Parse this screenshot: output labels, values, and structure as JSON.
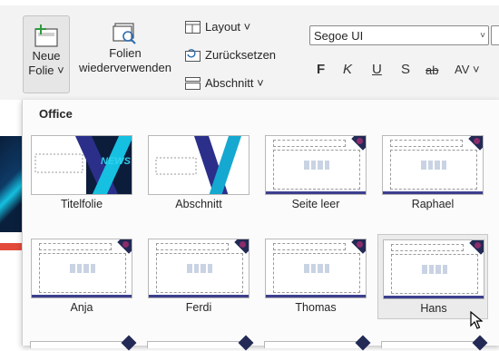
{
  "ribbon": {
    "new_slide_line1": "Neue",
    "new_slide_line2": "Folie ˅",
    "reuse_line1": "Folien",
    "reuse_line2": "wiederverwenden",
    "layout": "Layout ˅",
    "reset": "Zurücksetzen",
    "section": "Abschnitt ˅",
    "font_name": "Segoe UI",
    "format_bold": "F",
    "format_italic": "K",
    "format_underline": "U",
    "format_shadow": "S",
    "format_strike": "ab",
    "format_spacing": "AV ˅"
  },
  "gallery": {
    "group_title": "Office",
    "layouts": [
      {
        "label": "Titelfolie",
        "style": "title-news"
      },
      {
        "label": "Abschnitt",
        "style": "section"
      },
      {
        "label": "Seite leer",
        "style": "content"
      },
      {
        "label": "Raphael",
        "style": "content"
      },
      {
        "label": "Anja",
        "style": "content"
      },
      {
        "label": "Ferdi",
        "style": "content"
      },
      {
        "label": "Thomas",
        "style": "content"
      },
      {
        "label": "Hans",
        "style": "content",
        "hovered": true
      }
    ],
    "news_text": "NEWS"
  },
  "colors": {
    "ribbon_bg": "#f3f3f3",
    "accent_bar": "#3d3f8e",
    "corner_dark": "#222a55",
    "news_cyan": "#15c0e0"
  }
}
